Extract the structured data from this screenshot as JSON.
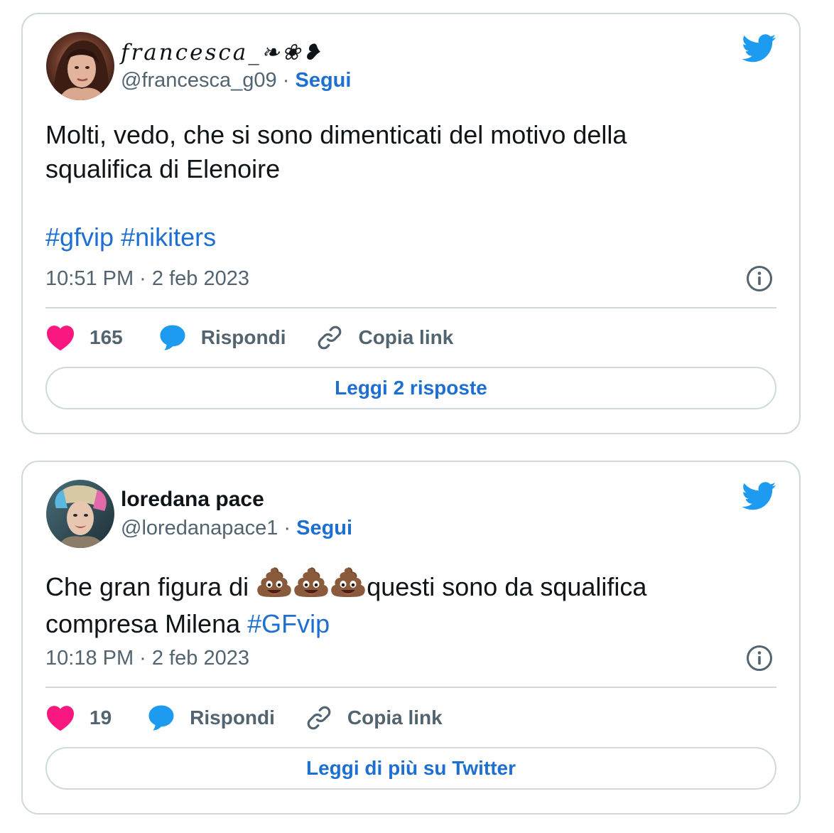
{
  "colors": {
    "link_blue": "#1d6fd1",
    "twitter_blue": "#1d9bf0",
    "heart_pink": "#f91880",
    "muted_text": "#536471",
    "border": "#cfd9de"
  },
  "tweets": [
    {
      "display_name": "francesca_❧❀❥",
      "handle": "@francesca_g09",
      "separator": "·",
      "follow_label": "Segui",
      "text_line1": "Molti, vedo, che si sono dimenticati del motivo della",
      "text_line2": "squalifica di Elenoire",
      "hashtag1": "#gfvip",
      "hashtag2": "#nikiters",
      "timestamp": "10:51 PM · 2 feb 2023",
      "like_count": "165",
      "reply_label": "Rispondi",
      "copy_label": "Copia link",
      "read_button_label": "Leggi 2 risposte",
      "icons": [
        "twitter-bird-icon",
        "info-icon",
        "heart-icon",
        "reply-bubble-icon",
        "link-icon"
      ]
    },
    {
      "display_name": "loredana pace",
      "handle": "@loredanapace1",
      "separator": "·",
      "follow_label": "Segui",
      "text_part1": "Che gran figura di ",
      "emoji_name": "pile-of-poo-emoji",
      "emoji_count": 3,
      "text_part2": "questi sono da squalifica",
      "text_line2": "compresa Milena ",
      "hashtag1": "#GFvip",
      "timestamp": "10:18 PM · 2 feb 2023",
      "like_count": "19",
      "reply_label": "Rispondi",
      "copy_label": "Copia link",
      "read_button_label": "Leggi di più su Twitter",
      "icons": [
        "twitter-bird-icon",
        "info-icon",
        "heart-icon",
        "reply-bubble-icon",
        "link-icon"
      ]
    }
  ]
}
